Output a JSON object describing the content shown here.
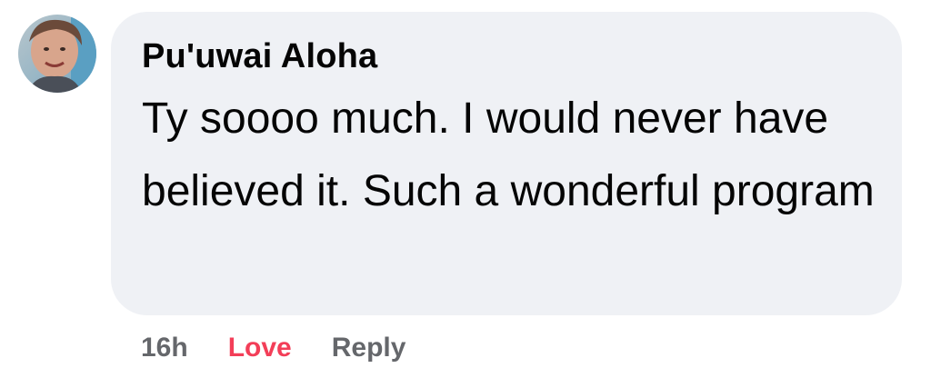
{
  "comment": {
    "author": "Pu'uwai Aloha",
    "text": "Ty soooo much. I would never have believed it. Such a wonderful program",
    "avatar": {
      "description_icon": "user-avatar",
      "accent": "#5a9fc2"
    }
  },
  "actions": {
    "time": "16h",
    "reaction_label": "Love",
    "reaction_color": "#f33e58",
    "reply_label": "Reply"
  },
  "colors": {
    "bubble": "#eff1f5",
    "text": "#050505",
    "muted": "#65676b"
  }
}
